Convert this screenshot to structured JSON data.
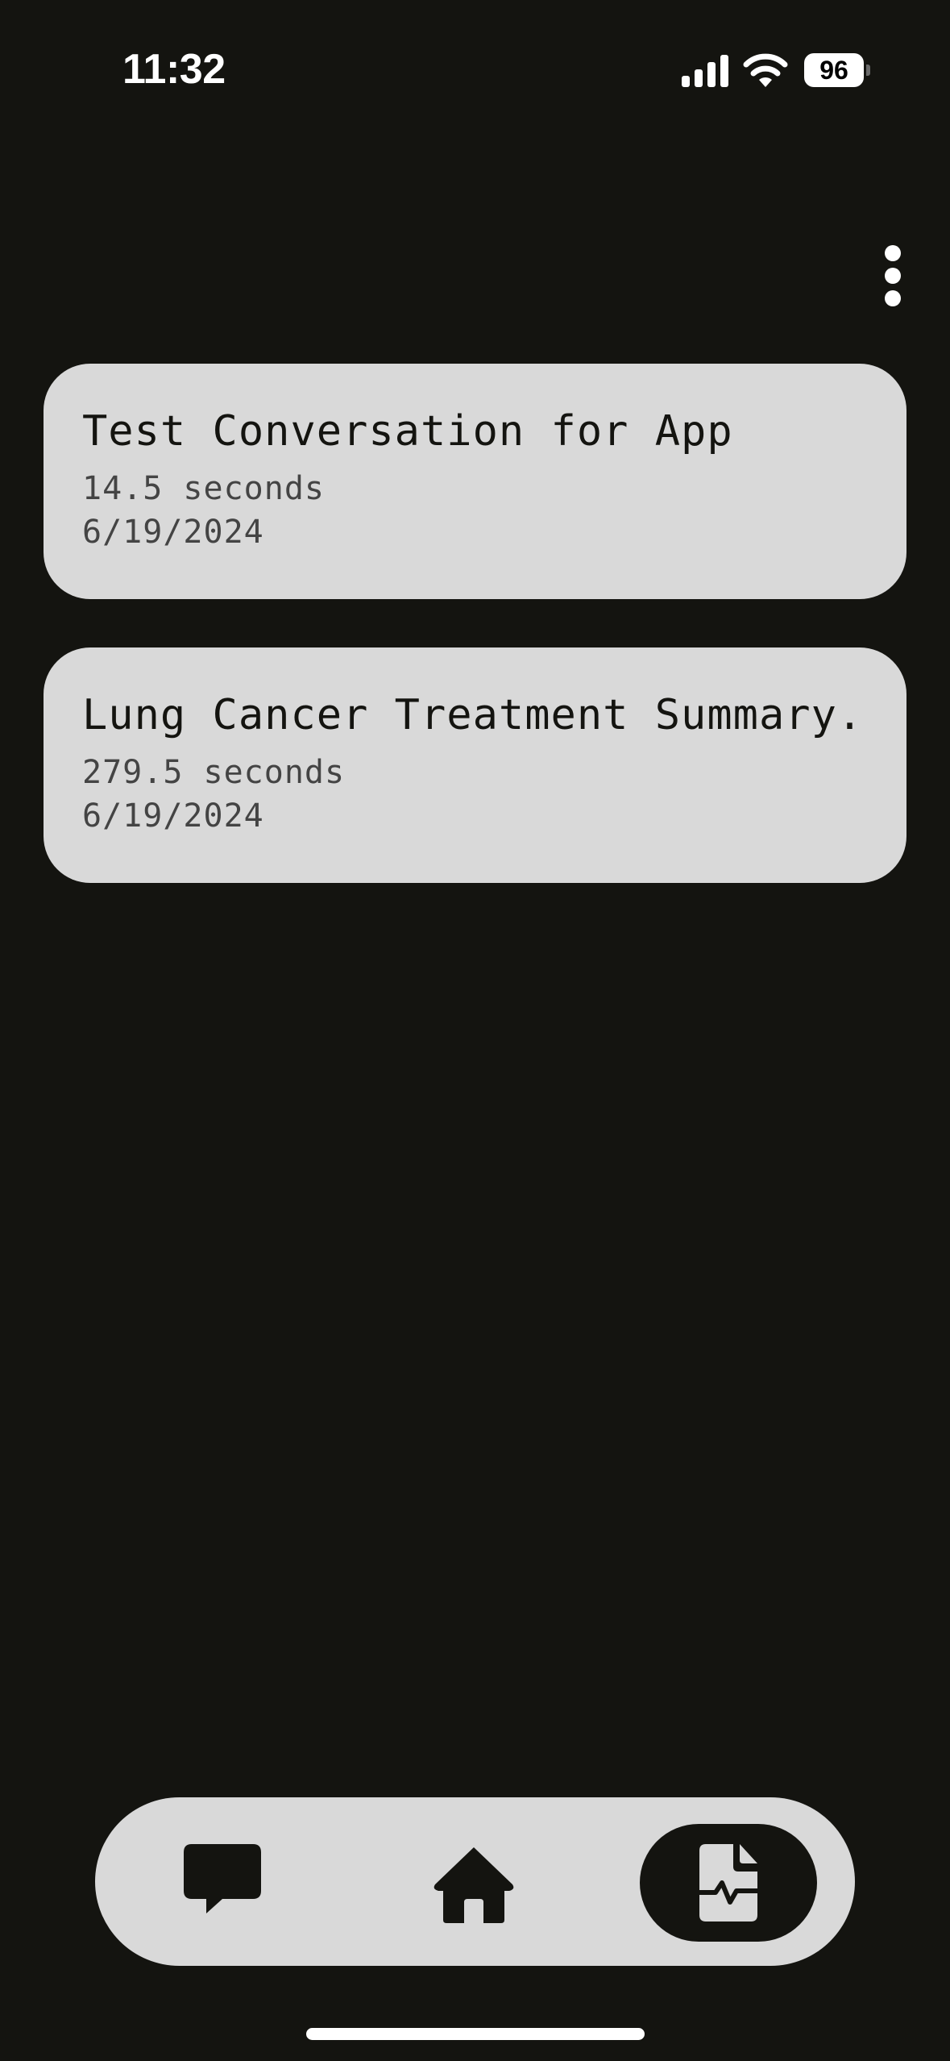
{
  "status_bar": {
    "time": "11:32",
    "battery": "96",
    "icons": [
      "cellular-signal-icon",
      "wifi-icon",
      "battery-icon"
    ]
  },
  "header": {
    "menu_icon": "more-vertical-icon"
  },
  "conversations": [
    {
      "title": "Test Conversation for App",
      "duration": "14.5 seconds",
      "date": "6/19/2024"
    },
    {
      "title": "Lung Cancer Treatment Summary.",
      "duration": "279.5 seconds",
      "date": "6/19/2024"
    }
  ],
  "nav": {
    "items": [
      {
        "icon": "chat-bubble-icon",
        "active": false
      },
      {
        "icon": "home-icon",
        "active": false
      },
      {
        "icon": "medical-report-icon",
        "active": true
      }
    ]
  },
  "colors": {
    "background": "#141410",
    "card": "#d9d9d9",
    "text_primary": "#141410",
    "text_secondary": "#444444",
    "active_nav": "#141410"
  }
}
